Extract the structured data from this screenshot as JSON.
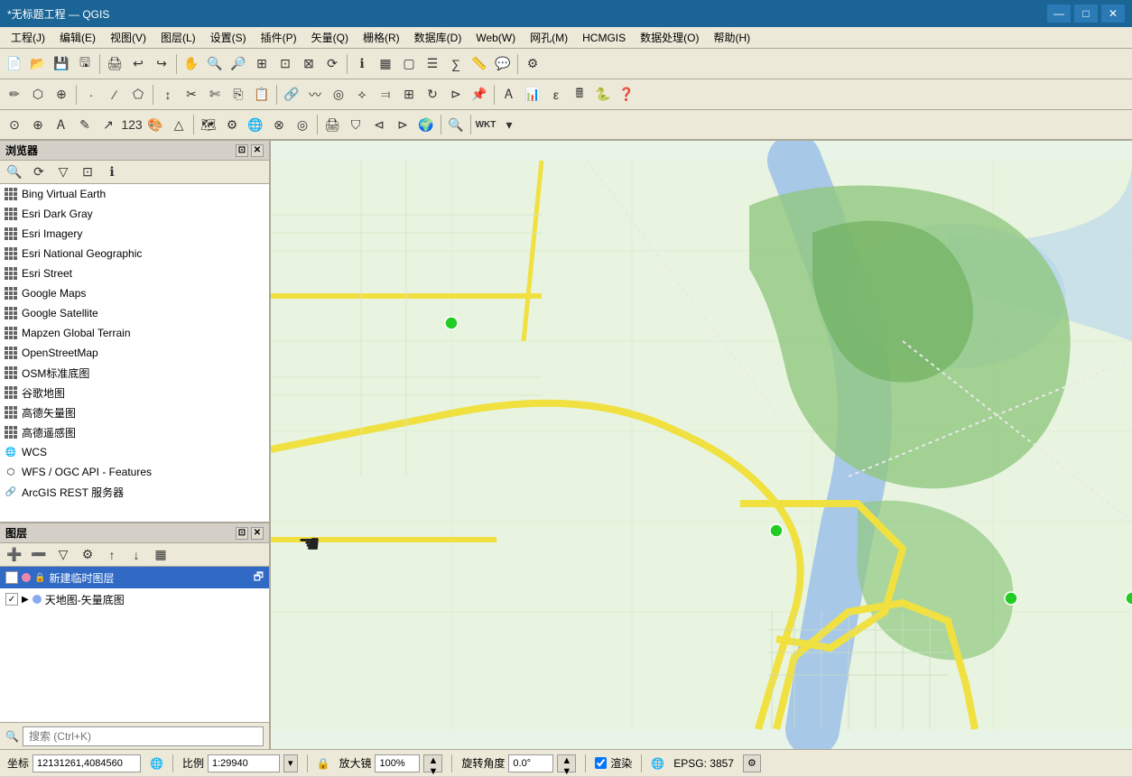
{
  "titlebar": {
    "title": "*无标题工程 — QGIS",
    "minimize": "—",
    "maximize": "□",
    "close": "✕"
  },
  "menubar": {
    "items": [
      {
        "label": "工程(J)"
      },
      {
        "label": "编辑(E)"
      },
      {
        "label": "视图(V)"
      },
      {
        "label": "图层(L)"
      },
      {
        "label": "设置(S)"
      },
      {
        "label": "插件(P)"
      },
      {
        "label": "矢量(Q)"
      },
      {
        "label": "栅格(R)"
      },
      {
        "label": "数据库(D)"
      },
      {
        "label": "Web(W)"
      },
      {
        "label": "网孔(M)"
      },
      {
        "label": "HCMGIS"
      },
      {
        "label": "数据处理(O)"
      },
      {
        "label": "帮助(H)"
      }
    ]
  },
  "browser_panel": {
    "title": "浏览器",
    "items": [
      {
        "label": "Bing Virtual Earth",
        "type": "grid"
      },
      {
        "label": "Esri Dark Gray",
        "type": "grid"
      },
      {
        "label": "Esri Imagery",
        "type": "grid"
      },
      {
        "label": "Esri National Geographic",
        "type": "grid"
      },
      {
        "label": "Esri Street",
        "type": "grid"
      },
      {
        "label": "Google Maps",
        "type": "grid"
      },
      {
        "label": "Google Satellite",
        "type": "grid"
      },
      {
        "label": "Mapzen Global Terrain",
        "type": "grid"
      },
      {
        "label": "OpenStreetMap",
        "type": "grid"
      },
      {
        "label": "OSM标准底图",
        "type": "grid"
      },
      {
        "label": "谷歌地图",
        "type": "grid"
      },
      {
        "label": "高德矢量图",
        "type": "grid"
      },
      {
        "label": "高德遥感图",
        "type": "grid"
      },
      {
        "label": "WCS",
        "type": "wcs"
      },
      {
        "label": "WFS / OGC API - Features",
        "type": "wfs"
      },
      {
        "label": "ArcGIS REST 服务器",
        "type": "arcgis"
      }
    ]
  },
  "layers_panel": {
    "title": "图层",
    "layers": [
      {
        "label": "新建临时图层",
        "checked": true,
        "selected": true,
        "color": "#ee88aa"
      },
      {
        "label": "天地图-矢量底图",
        "checked": true,
        "selected": false,
        "color": "#88aaee",
        "has_child": true
      }
    ]
  },
  "statusbar": {
    "coords_label": "坐标",
    "coords_value": "12131261,4084560",
    "scale_label": "比例",
    "scale_value": "1:29940",
    "lock_label": "放大镜",
    "zoom_value": "100%",
    "rotation_label": "旋转角度",
    "rotation_value": "0.0°",
    "render_label": "渲染",
    "epsg_label": "EPSG: 3857"
  },
  "search": {
    "placeholder": "搜索 (Ctrl+K)"
  }
}
